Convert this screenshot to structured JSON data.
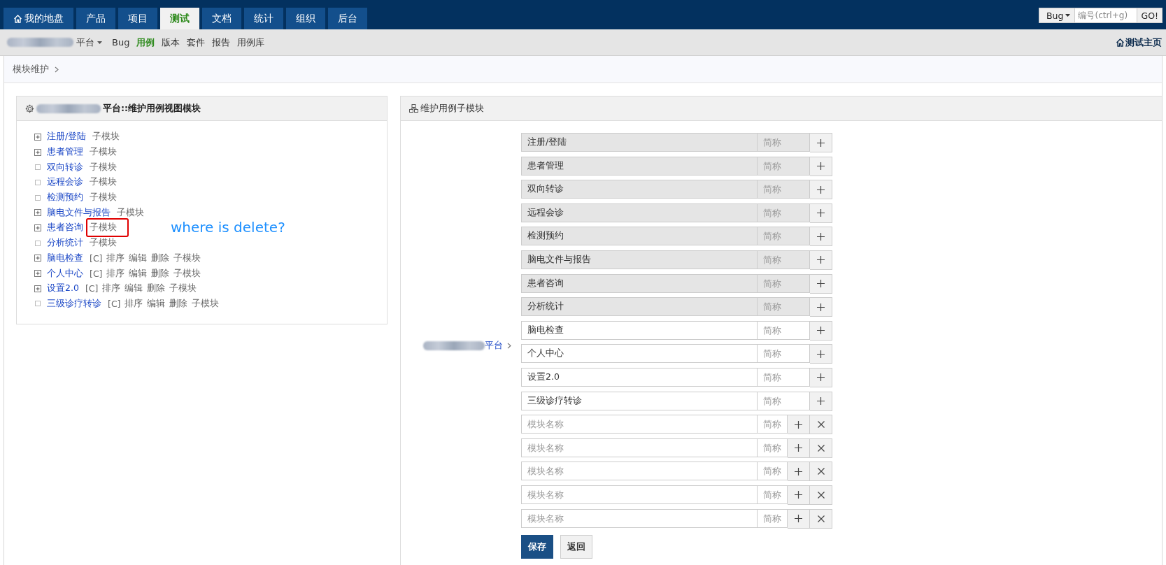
{
  "nav": {
    "tabs": [
      {
        "label": "我的地盘",
        "selected": false,
        "home": true
      },
      {
        "label": "产品",
        "selected": false,
        "home": false
      },
      {
        "label": "项目",
        "selected": false,
        "home": false
      },
      {
        "label": "测试",
        "selected": true,
        "home": false
      },
      {
        "label": "文档",
        "selected": false,
        "home": false
      },
      {
        "label": "统计",
        "selected": false,
        "home": false
      },
      {
        "label": "组织",
        "selected": false,
        "home": false
      },
      {
        "label": "后台",
        "selected": false,
        "home": false
      }
    ],
    "quick_jump": {
      "type": "Bug",
      "placeholder": "编号(ctrl+g)",
      "button": "GO!"
    }
  },
  "subnav": {
    "product": "平台",
    "items": [
      {
        "label": "Bug",
        "selected": false
      },
      {
        "label": "用例",
        "selected": true
      },
      {
        "label": "版本",
        "selected": false
      },
      {
        "label": "套件",
        "selected": false
      },
      {
        "label": "报告",
        "selected": false
      },
      {
        "label": "用例库",
        "selected": false
      }
    ],
    "home_link": "测试主页"
  },
  "breadcrumb": "模块维护",
  "left_panel": {
    "title": "平台::维护用例视图模块",
    "modules": [
      {
        "name": "注册/登陆",
        "expandable": true,
        "flagged": false,
        "links": [
          "子模块"
        ]
      },
      {
        "name": "患者管理",
        "expandable": true,
        "flagged": false,
        "links": [
          "子模块"
        ]
      },
      {
        "name": "双向转诊",
        "expandable": false,
        "flagged": false,
        "links": [
          "子模块"
        ]
      },
      {
        "name": "远程会诊",
        "expandable": false,
        "flagged": false,
        "links": [
          "子模块"
        ]
      },
      {
        "name": "检测预约",
        "expandable": false,
        "flagged": false,
        "links": [
          "子模块"
        ]
      },
      {
        "name": "脑电文件与报告",
        "expandable": true,
        "flagged": false,
        "links": [
          "子模块"
        ]
      },
      {
        "name": "患者咨询",
        "expandable": true,
        "flagged": true,
        "links": [
          "子模块"
        ]
      },
      {
        "name": "分析统计",
        "expandable": false,
        "flagged": false,
        "links": [
          "子模块"
        ]
      },
      {
        "name": "脑电检查",
        "expandable": true,
        "flagged": false,
        "links": [
          "[C]",
          "排序",
          "编辑",
          "删除",
          "子模块"
        ]
      },
      {
        "name": "个人中心",
        "expandable": true,
        "flagged": false,
        "links": [
          "[C]",
          "排序",
          "编辑",
          "删除",
          "子模块"
        ]
      },
      {
        "name": "设置2.0",
        "expandable": true,
        "flagged": false,
        "links": [
          "[C]",
          "排序",
          "编辑",
          "删除",
          "子模块"
        ]
      },
      {
        "name": "三级诊疗转诊",
        "expandable": false,
        "flagged": false,
        "links": [
          "[C]",
          "排序",
          "编辑",
          "删除",
          "子模块"
        ]
      }
    ],
    "annotation": "where is delete?"
  },
  "right_panel": {
    "title": "维护用例子模块",
    "path": "平台",
    "rows": [
      {
        "kind": "existing",
        "value": "注册/登陆",
        "readonly": true,
        "short_placeholder": "简称"
      },
      {
        "kind": "existing",
        "value": "患者管理",
        "readonly": true,
        "short_placeholder": "简称"
      },
      {
        "kind": "existing",
        "value": "双向转诊",
        "readonly": true,
        "short_placeholder": "简称"
      },
      {
        "kind": "existing",
        "value": "远程会诊",
        "readonly": true,
        "short_placeholder": "简称"
      },
      {
        "kind": "existing",
        "value": "检测预约",
        "readonly": true,
        "short_placeholder": "简称"
      },
      {
        "kind": "existing",
        "value": "脑电文件与报告",
        "readonly": true,
        "short_placeholder": "简称"
      },
      {
        "kind": "existing",
        "value": "患者咨询",
        "readonly": true,
        "short_placeholder": "简称"
      },
      {
        "kind": "existing",
        "value": "分析统计",
        "readonly": true,
        "short_placeholder": "简称"
      },
      {
        "kind": "existing",
        "value": "脑电检查",
        "readonly": false,
        "short_placeholder": "简称"
      },
      {
        "kind": "existing",
        "value": "个人中心",
        "readonly": false,
        "short_placeholder": "简称"
      },
      {
        "kind": "existing",
        "value": "设置2.0",
        "readonly": false,
        "short_placeholder": "简称"
      },
      {
        "kind": "existing",
        "value": "三级诊疗转诊",
        "readonly": false,
        "short_placeholder": "简称"
      },
      {
        "kind": "new",
        "placeholder": "模块名称",
        "short_placeholder": "简称"
      },
      {
        "kind": "new",
        "placeholder": "模块名称",
        "short_placeholder": "简称"
      },
      {
        "kind": "new",
        "placeholder": "模块名称",
        "short_placeholder": "简称"
      },
      {
        "kind": "new",
        "placeholder": "模块名称",
        "short_placeholder": "简称"
      },
      {
        "kind": "new",
        "placeholder": "模块名称",
        "short_placeholder": "简称"
      }
    ],
    "buttons": [
      {
        "label": "保存",
        "kind": "primary"
      },
      {
        "label": "返回",
        "kind": "default"
      }
    ]
  }
}
